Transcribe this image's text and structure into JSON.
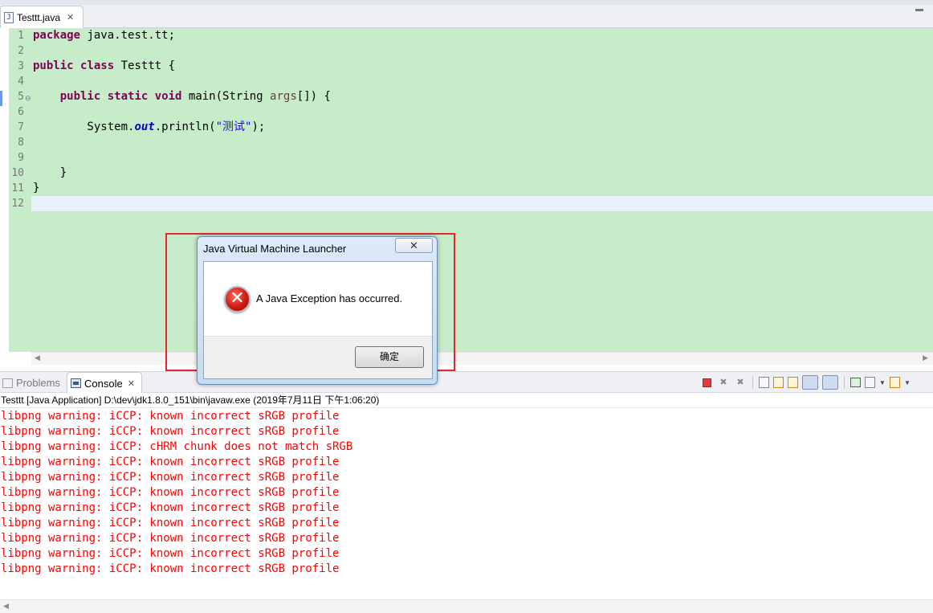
{
  "editor": {
    "tab_label": "Testtt.java",
    "tab_close": "✕",
    "code": [
      {
        "n": "1",
        "tokens": [
          {
            "t": "package",
            "c": "kw"
          },
          {
            "t": " java.test.tt;",
            "c": ""
          }
        ]
      },
      {
        "n": "2",
        "tokens": []
      },
      {
        "n": "3",
        "tokens": [
          {
            "t": "public",
            "c": "kw"
          },
          {
            "t": " ",
            "c": ""
          },
          {
            "t": "class",
            "c": "kw"
          },
          {
            "t": " Testtt {",
            "c": ""
          }
        ]
      },
      {
        "n": "4",
        "tokens": []
      },
      {
        "n": "5",
        "tokens": [
          {
            "t": "    ",
            "c": ""
          },
          {
            "t": "public",
            "c": "kw"
          },
          {
            "t": " ",
            "c": ""
          },
          {
            "t": "static",
            "c": "kw"
          },
          {
            "t": " ",
            "c": ""
          },
          {
            "t": "void",
            "c": "kw"
          },
          {
            "t": " main(String ",
            "c": ""
          },
          {
            "t": "args",
            "c": "param"
          },
          {
            "t": "[]) {",
            "c": ""
          }
        ]
      },
      {
        "n": "6",
        "tokens": []
      },
      {
        "n": "7",
        "tokens": [
          {
            "t": "        System.",
            "c": ""
          },
          {
            "t": "out",
            "c": "field"
          },
          {
            "t": ".println(",
            "c": ""
          },
          {
            "t": "\"测试\"",
            "c": "str"
          },
          {
            "t": ");",
            "c": ""
          }
        ]
      },
      {
        "n": "8",
        "tokens": []
      },
      {
        "n": "9",
        "tokens": []
      },
      {
        "n": "10",
        "tokens": [
          {
            "t": "    }",
            "c": ""
          }
        ]
      },
      {
        "n": "11",
        "tokens": [
          {
            "t": "}",
            "c": ""
          }
        ]
      },
      {
        "n": "12",
        "tokens": []
      }
    ]
  },
  "panel": {
    "tabs": {
      "problems": "Problems",
      "console": "Console",
      "close": "✕"
    },
    "process_line": "Testtt [Java Application] D:\\dev\\jdk1.8.0_151\\bin\\javaw.exe (2019年7月11日 下午1:06:20)",
    "output": [
      "libpng warning: iCCP: known incorrect sRGB profile",
      "libpng warning: iCCP: known incorrect sRGB profile",
      "libpng warning: iCCP: cHRM chunk does not match sRGB",
      "libpng warning: iCCP: known incorrect sRGB profile",
      "libpng warning: iCCP: known incorrect sRGB profile",
      "libpng warning: iCCP: known incorrect sRGB profile",
      "libpng warning: iCCP: known incorrect sRGB profile",
      "libpng warning: iCCP: known incorrect sRGB profile",
      "libpng warning: iCCP: known incorrect sRGB profile",
      "libpng warning: iCCP: known incorrect sRGB profile",
      "libpng warning: iCCP: known incorrect sRGB profile"
    ]
  },
  "dialog": {
    "title": "Java Virtual Machine Launcher",
    "close": "✕",
    "message": "A Java Exception has occurred.",
    "ok_label": "确定",
    "icon": "error-icon"
  },
  "colors": {
    "editor_bg": "#c7ecca",
    "keyword": "#7f0055",
    "string": "#2a00ff",
    "field": "#0000c0",
    "console_error": "#ff0000",
    "highlight_box": "#e8242c"
  }
}
